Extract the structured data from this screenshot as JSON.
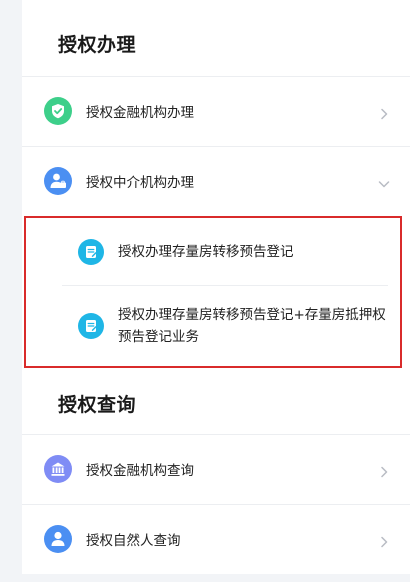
{
  "sections": {
    "authorization_handling": {
      "title": "授权办理",
      "items": [
        {
          "label": "授权金融机构办理",
          "icon": "shield-check-icon",
          "icon_color": "#3dcf8a",
          "chevron": "chevron-right-icon"
        },
        {
          "label": "授权中介机构办理",
          "icon": "agent-person-icon",
          "icon_color": "#4b8ff2",
          "chevron": "chevron-down-icon"
        }
      ],
      "sub_items": [
        {
          "label": "授权办理存量房转移预告登记",
          "icon": "document-edit-icon",
          "icon_color": "#1fb6e6"
        },
        {
          "label": "授权办理存量房转移预告登记+存量房抵押权预告登记业务",
          "icon": "document-edit-icon",
          "icon_color": "#1fb6e6"
        }
      ]
    },
    "authorization_query": {
      "title": "授权查询",
      "items": [
        {
          "label": "授权金融机构查询",
          "icon": "bank-icon",
          "icon_color": "#7f8cf5",
          "chevron": "chevron-right-icon"
        },
        {
          "label": "授权自然人查询",
          "icon": "person-icon",
          "icon_color": "#4b8ff2",
          "chevron": "chevron-right-icon"
        }
      ]
    }
  },
  "colors": {
    "highlight_border": "#d92b2b",
    "chevron": "#b8bcc4",
    "page_bg": "#f2f4f7"
  }
}
